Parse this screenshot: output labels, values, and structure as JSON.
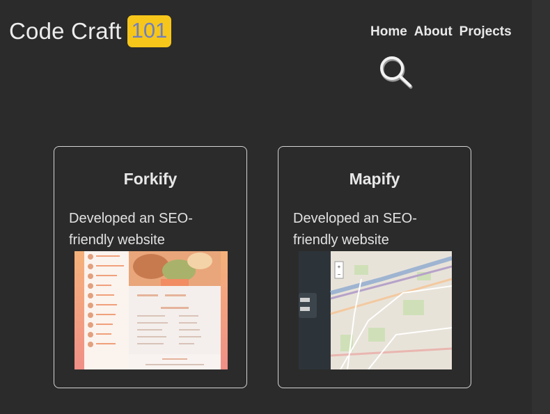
{
  "header": {
    "logo_text": "Code Craft",
    "logo_badge": "101",
    "nav": [
      "Home",
      "About",
      "Projects"
    ],
    "search_icon": "search-icon"
  },
  "projects": [
    {
      "title": "Forkify",
      "description": "Developed an SEO-friendly website",
      "thumbnail": "forkify-screenshot"
    },
    {
      "title": "Mapify",
      "description": "Developed an SEO-friendly website",
      "thumbnail": "mapify-screenshot"
    }
  ],
  "colors": {
    "background": "#2b2b2b",
    "badge": "#f6c61b",
    "badge_text": "#6f7fbf",
    "card_border": "#d4d4d4"
  }
}
